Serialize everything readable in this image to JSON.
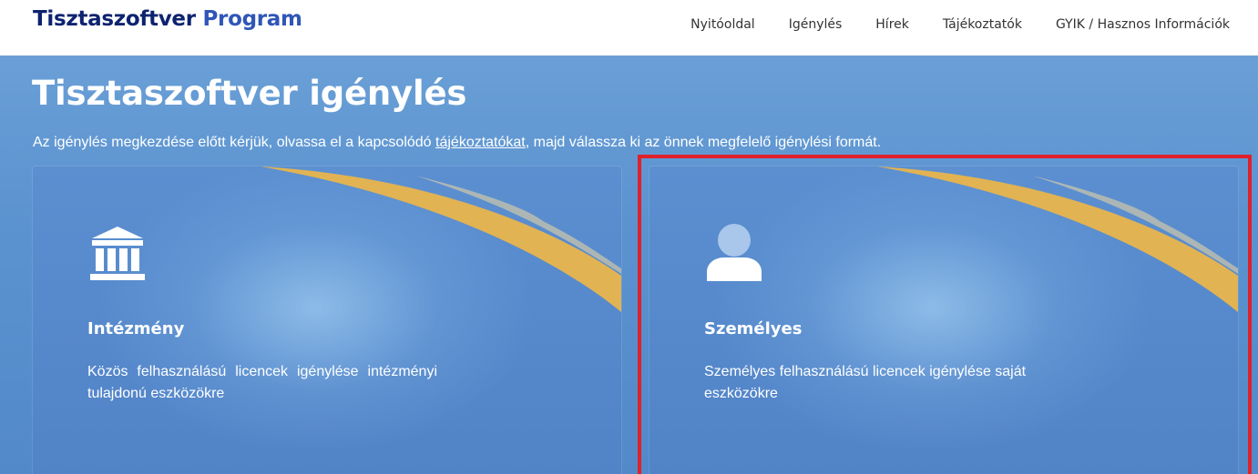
{
  "header": {
    "brand_main": "Tisztaszoftver",
    "brand_accent": "Program",
    "nav": [
      "Nyitóoldal",
      "Igénylés",
      "Hírek",
      "Tájékoztatók",
      "GYIK / Hasznos Információk"
    ]
  },
  "hero": {
    "title": "Tisztaszoftver igénylés",
    "desc_before": "Az igénylés megkezdése előtt kérjük, olvassa el a kapcsolódó ",
    "desc_link": "tájékoztatókat",
    "desc_after": ", majd válassza ki az önnek megfelelő igénylési formát."
  },
  "cards": [
    {
      "icon": "institution-icon",
      "title": "Intézmény",
      "text": "Közös felhasználású licencek igénylése intézményi tulajdonú eszközökre"
    },
    {
      "icon": "user-icon",
      "title": "Személyes",
      "text": "Személyes felhasználású licencek igénylése saját eszközökre"
    }
  ],
  "colors": {
    "brand": "#0d2370",
    "brand_accent": "#2f56b8",
    "hero_bg": "#5b93d0",
    "swoosh": "#e1b353",
    "highlight": "#e0202a"
  }
}
